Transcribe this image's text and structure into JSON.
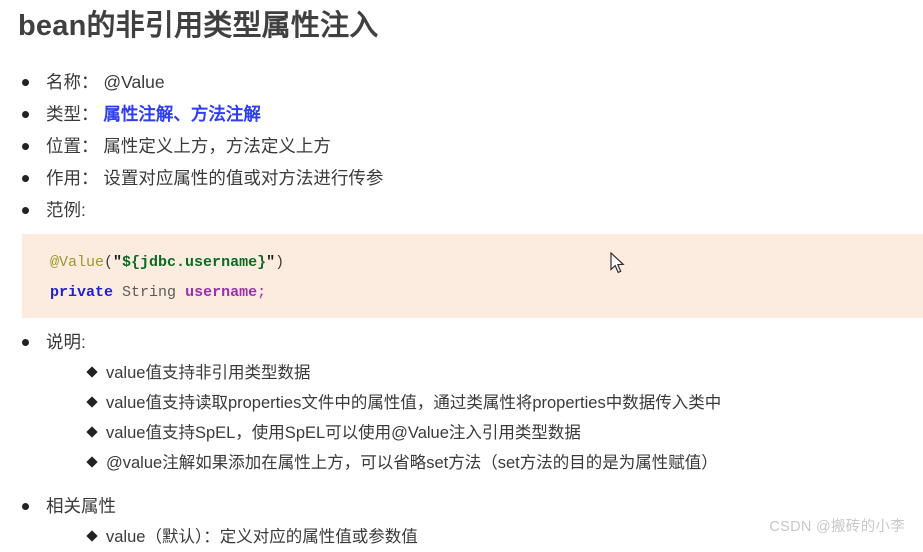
{
  "page": {
    "title": "bean的非引用类型属性注入",
    "background": "#ffffff",
    "accent_color": "#2e3ef0",
    "code_background": "#fcece0"
  },
  "bullets": [
    {
      "label": "名称：",
      "value": "@Value",
      "emphasis": false
    },
    {
      "label": "类型：",
      "value": "属性注解、方法注解",
      "emphasis": true
    },
    {
      "label": "位置：",
      "value": "属性定义上方，方法定义上方",
      "emphasis": false
    },
    {
      "label": "作用：",
      "value": "设置对应属性的值或对方法进行传参",
      "emphasis": false
    },
    {
      "label": "范例:",
      "value": "",
      "emphasis": false
    }
  ],
  "code": {
    "line1": {
      "annotation": "@Value",
      "open_paren": "(",
      "open_quote": "\"",
      "string": "${jdbc.username}",
      "close_quote": "\"",
      "close_paren": ")"
    },
    "line2": {
      "keyword": "private",
      "space1": " ",
      "type": "String",
      "space2": " ",
      "variable": "username",
      "semicolon": ";"
    }
  },
  "sections": [
    {
      "heading": "说明:",
      "items": [
        "value值支持非引用类型数据",
        "value值支持读取properties文件中的属性值，通过类属性将properties中数据传入类中",
        "value值支持SpEL，使用SpEL可以使用@Value注入引用类型数据",
        "@value注解如果添加在属性上方，可以省略set方法（set方法的目的是为属性赋值）"
      ]
    },
    {
      "heading": "相关属性",
      "items": [
        "value（默认）：定义对应的属性值或参数值"
      ]
    }
  ],
  "watermark": "CSDN @搬砖的小李",
  "cursor": {
    "icon": "arrow-pointer"
  }
}
